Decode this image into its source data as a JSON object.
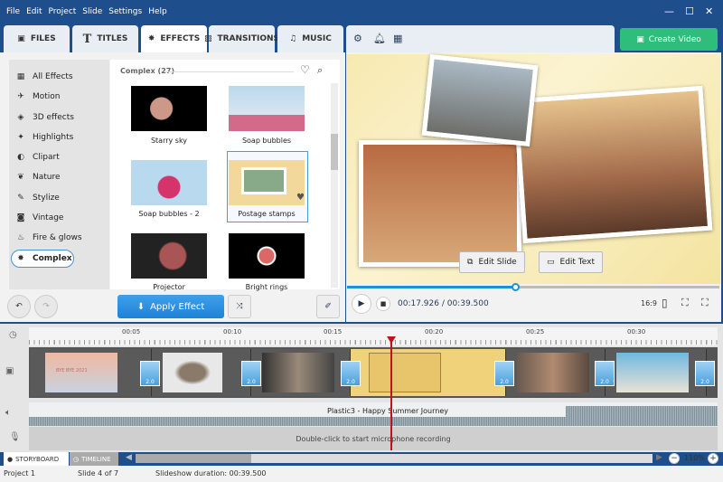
{
  "menu": [
    "File",
    "Edit",
    "Project",
    "Slide",
    "Settings",
    "Help"
  ],
  "tabs": [
    {
      "label": "FILES",
      "icon": "add-file-icon"
    },
    {
      "label": "TITLES",
      "icon": "text-icon"
    },
    {
      "label": "EFFECTS",
      "icon": "effects-star-icon",
      "active": true
    },
    {
      "label": "TRANSITIONS",
      "icon": "transitions-icon"
    },
    {
      "label": "MUSIC",
      "icon": "music-icon"
    }
  ],
  "create_video": "Create Video",
  "categories": [
    "All Effects",
    "Motion",
    "3D effects",
    "Highlights",
    "Clipart",
    "Nature",
    "Stylize",
    "Vintage",
    "Fire & glows",
    "Complex"
  ],
  "selected_category": "Complex",
  "grid_header": "Complex (27)",
  "effects": [
    "Starry sky",
    "Soap bubbles",
    "Soap bubbles - 2",
    "Postage stamps",
    "Projector",
    "Bright rings"
  ],
  "selected_effect": "Postage stamps",
  "apply_effect": "Apply Effect",
  "preview": {
    "edit_slide": "Edit Slide",
    "edit_text": "Edit Text",
    "time": "00:17.926 / 00:39.500",
    "progress": 0.454,
    "aspect": "16:9"
  },
  "ruler": [
    "00:05",
    "00:10",
    "00:15",
    "00:20",
    "00:25",
    "00:30"
  ],
  "transition_duration": "2.0",
  "slide1_text": "BYE BYE 2021",
  "audio_track": "Plastic3 - Happy Summer Journey",
  "mic_hint": "Double-click to start microphone recording",
  "view_tabs": [
    "STORYBOARD",
    "TIMELINE"
  ],
  "zoom": "110%",
  "status": {
    "project": "Project 1",
    "slide": "Slide 4 of 7",
    "duration": "Slideshow duration: 00:39.500"
  },
  "colors": {
    "titlebar": "#1f4e8c",
    "accent": "#1e82d6",
    "create": "#2ebd7a",
    "playhead": "#c0141c",
    "selected_slide": "#f0d27a"
  }
}
